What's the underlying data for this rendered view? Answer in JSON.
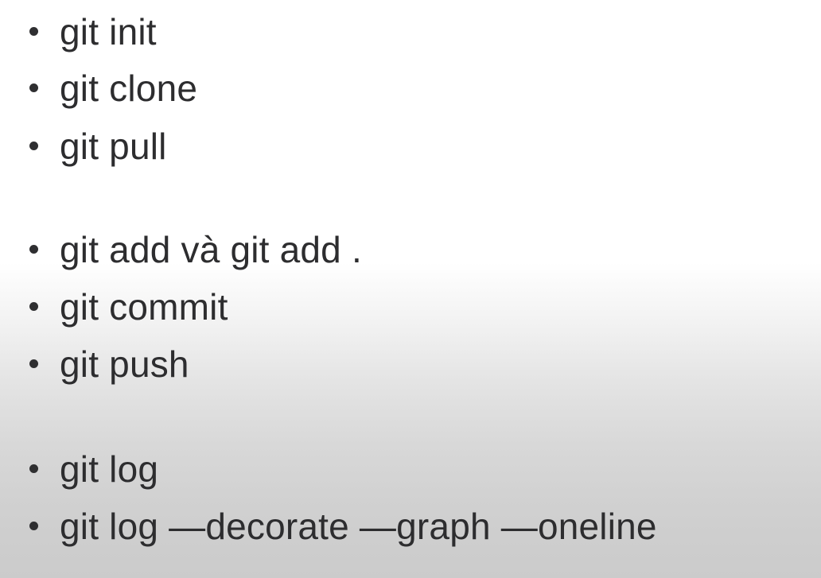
{
  "slide": {
    "groups": [
      {
        "items": [
          {
            "text": "git init"
          },
          {
            "text": "git clone"
          },
          {
            "text": "git pull"
          }
        ]
      },
      {
        "items": [
          {
            "text": "git add và git add ."
          },
          {
            "text": "git commit"
          },
          {
            "text": "git push"
          }
        ]
      },
      {
        "items": [
          {
            "text": "git log"
          },
          {
            "text": "git log —decorate —graph —oneline"
          }
        ]
      }
    ]
  }
}
